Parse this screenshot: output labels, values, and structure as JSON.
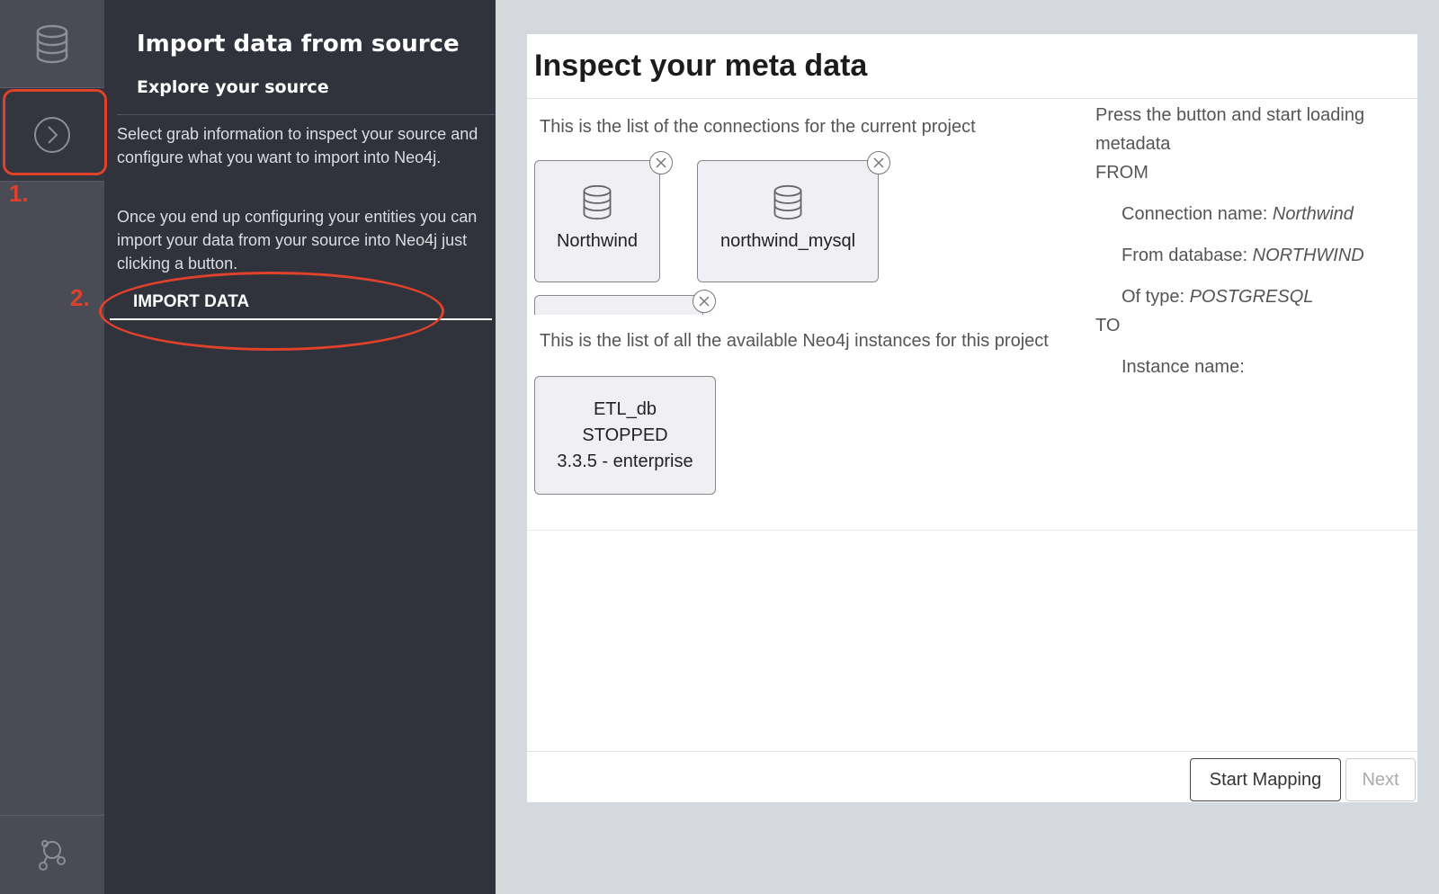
{
  "sidebar": {
    "icons": [
      "database-icon",
      "explore-source-icon",
      "neo4j-logo-icon"
    ]
  },
  "panel": {
    "title": "Import data from source",
    "subtitle": "Explore your source",
    "paragraph1": "Select grab information to inspect your source and configure what you want to import into Neo4j.",
    "paragraph2": "Once you end up configuring your entities you can import your data from your source into Neo4j just clicking a button.",
    "import_button": "IMPORT DATA"
  },
  "annotations": {
    "step1": "1.",
    "step2": "2.",
    "color": "#e0412a"
  },
  "main": {
    "title": "Inspect your meta data",
    "connections_label": "This is the list of the connections for the current project",
    "connections": [
      {
        "name": "Northwind"
      },
      {
        "name": "northwind_mysql"
      }
    ],
    "instances_label": "This is the list of all the available Neo4j instances for this project",
    "instance": {
      "name": "ETL_db",
      "status": "STOPPED",
      "version": "3.3.5 - enterprise"
    },
    "info": {
      "intro": "Press the button and start loading metadata",
      "from": "FROM",
      "connection_name_label": "Connection name:",
      "connection_name_value": "Northwind",
      "from_database_label": "From database:",
      "from_database_value": "NORTHWIND",
      "type_label": "Of type:",
      "type_value": "POSTGRESQL",
      "to": "TO",
      "instance_name_label": "Instance name:"
    },
    "buttons": {
      "start_mapping": "Start Mapping",
      "next": "Next"
    }
  }
}
